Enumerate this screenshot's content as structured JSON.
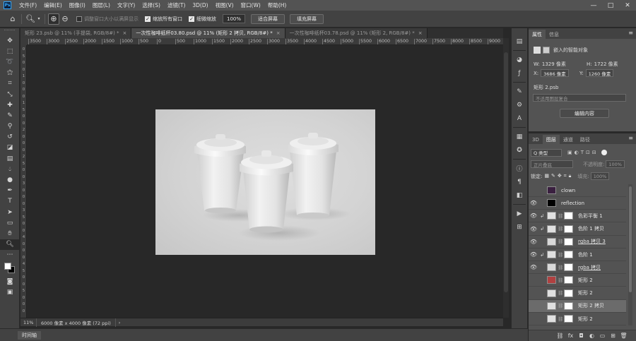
{
  "menubar": {
    "logo": "Ps",
    "items": [
      "文件(F)",
      "编辑(E)",
      "图像(I)",
      "图层(L)",
      "文字(Y)",
      "选择(S)",
      "滤镜(T)",
      "3D(D)",
      "视图(V)",
      "窗口(W)",
      "帮助(H)"
    ],
    "window_controls": [
      "—",
      "□",
      "✕"
    ]
  },
  "options": {
    "resize_windows": "调整窗口大小以满屏显示",
    "zoom_all_windows": "缩放所有窗口",
    "scrubby_zoom": "细微缩放",
    "zoom_value": "100%",
    "fit_screen": "适合屏幕",
    "fill_screen": "填充屏幕"
  },
  "tabs": [
    {
      "label": "矩形 23.psb @ 11% (手提袋, RGB/8#) *",
      "active": false
    },
    {
      "label": "一次性咖啡纸杯03.80.psd @ 11% (矩形 2 拷贝, RGB/8#) *",
      "active": true
    },
    {
      "label": "一次性咖啡纸杯03.78.psd @ 11% (矩形 2, RGB/8#) *",
      "active": false
    }
  ],
  "ruler": {
    "top_labels": [
      "3500",
      "3000",
      "2500",
      "2000",
      "1500",
      "1000",
      "500",
      "0",
      "500",
      "1000",
      "1500",
      "2000",
      "2500",
      "3000",
      "3500",
      "4000",
      "4500",
      "5000",
      "5500",
      "6000",
      "6500",
      "7000",
      "7500",
      "8000",
      "8500",
      "9000"
    ],
    "left_labels": [
      "0",
      "5",
      "0",
      "0",
      "1",
      "0",
      "0",
      "0",
      "1",
      "5",
      "0",
      "0",
      "2",
      "0",
      "0",
      "0",
      "2",
      "5",
      "0",
      "0",
      "3",
      "0",
      "0",
      "0",
      "3",
      "5",
      "0",
      "0",
      "4",
      "0",
      "0",
      "0",
      "4",
      "5",
      "0",
      "0",
      "5",
      "0",
      "0",
      "0"
    ]
  },
  "status": {
    "zoom": "11%",
    "doc_info": "6000 像素 x 4000 像素 (72 ppi)",
    "arrow": "›"
  },
  "timeline": {
    "label": "时间轴"
  },
  "properties": {
    "tabs": [
      "属性",
      "信息"
    ],
    "object_type": "嵌入的智能对象",
    "w_label": "W:",
    "w_value": "1329 像素",
    "h_label": "H:",
    "h_value": "1722 像素",
    "x_label": "X:",
    "x_value": "3686 像素",
    "y_label": "Y:",
    "y_value": "1260 像素",
    "file_name": "矩形 2.psb",
    "comp_placeholder": "不适用图层复合",
    "edit_contents": "编辑内容"
  },
  "layers_panel": {
    "tabs": [
      "3D",
      "图层",
      "通道",
      "路径"
    ],
    "filter_label": "Q 类型",
    "blend_mode": "正片叠底",
    "opacity_label": "不透明度:",
    "opacity_value": "100%",
    "lock_label": "锁定:",
    "fill_label": "填充:",
    "fill_value": "100%",
    "layers": [
      {
        "name": "clown",
        "visible": false,
        "clip": false,
        "link": false,
        "thumb": "#3a2040",
        "mask": false,
        "underline": false,
        "selected": false
      },
      {
        "name": "reflection",
        "visible": true,
        "clip": false,
        "link": false,
        "thumb": "#000000",
        "mask": false,
        "underline": false,
        "selected": false
      },
      {
        "name": "色彩平衡 1",
        "visible": true,
        "clip": true,
        "link": true,
        "thumb": "#e0e0e0",
        "mask": true,
        "underline": false,
        "selected": false
      },
      {
        "name": "色阶 1 拷贝",
        "visible": true,
        "clip": true,
        "link": true,
        "thumb": "#e0e0e0",
        "mask": true,
        "underline": false,
        "selected": false
      },
      {
        "name": "rgba 拷贝 3",
        "visible": true,
        "clip": false,
        "link": true,
        "thumb": "#d8d8d8",
        "mask": true,
        "underline": true,
        "selected": false
      },
      {
        "name": "色阶 1",
        "visible": true,
        "clip": true,
        "link": true,
        "thumb": "#e0e0e0",
        "mask": true,
        "underline": false,
        "selected": false
      },
      {
        "name": "rgba 拷贝",
        "visible": true,
        "clip": false,
        "link": true,
        "thumb": "#d8d8d8",
        "mask": true,
        "underline": true,
        "selected": false
      },
      {
        "name": "矩形 2",
        "visible": false,
        "clip": false,
        "link": true,
        "thumb": "#b04040",
        "mask": true,
        "underline": false,
        "selected": false
      },
      {
        "name": "矩形 2",
        "visible": false,
        "clip": false,
        "link": true,
        "thumb": "#e0e0e0",
        "mask": true,
        "underline": false,
        "selected": false
      },
      {
        "name": "矩形 2 拷贝",
        "visible": false,
        "clip": false,
        "link": true,
        "thumb": "#e0e0e0",
        "mask": true,
        "underline": false,
        "selected": true
      },
      {
        "name": "矩形 2",
        "visible": false,
        "clip": false,
        "link": true,
        "thumb": "#e0e0e0",
        "mask": true,
        "underline": false,
        "selected": false
      }
    ],
    "footer_icons": [
      "link-layers-icon",
      "fx-icon",
      "mask-icon",
      "adjustment-icon",
      "group-icon",
      "new-layer-icon",
      "trash-icon"
    ]
  }
}
